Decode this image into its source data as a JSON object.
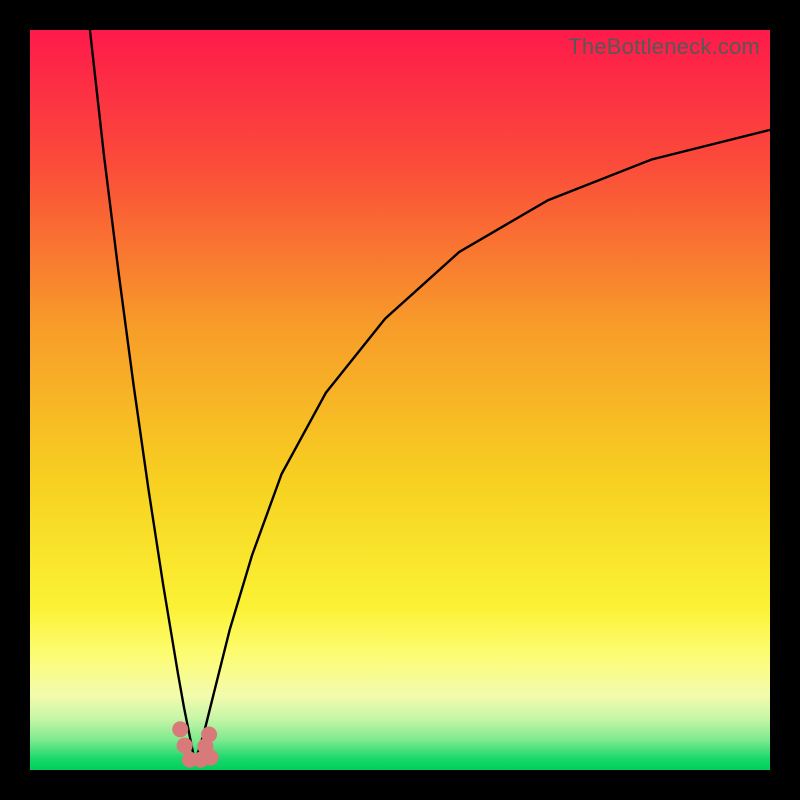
{
  "watermark": "TheBottleneck.com",
  "chart_data": {
    "type": "line",
    "title": "",
    "xlabel": "",
    "ylabel": "",
    "xlim": [
      0,
      100
    ],
    "ylim": [
      0,
      100
    ],
    "grid": false,
    "legend": false,
    "description": "Bottleneck chart: background gradient from red (top, high bottleneck) through orange/yellow to thin green band (bottom, 0%). Two black curves descend from top into a V-shaped trough at ~x=22, y≈0, then one rises steeply back toward top-right. A cluster of salmon dots sits in the trough near y=0.",
    "series": [
      {
        "name": "left-curve",
        "x": [
          8.1,
          10,
          12,
          14,
          16,
          18,
          19,
          20,
          20.8,
          21.6,
          22.3
        ],
        "y": [
          100,
          83,
          67,
          52,
          38,
          25,
          19,
          13,
          8.5,
          4.5,
          1.0
        ]
      },
      {
        "name": "right-curve",
        "x": [
          22.3,
          23.5,
          25,
          27,
          30,
          34,
          40,
          48,
          58,
          70,
          84,
          100
        ],
        "y": [
          1.0,
          5.0,
          11,
          19,
          29,
          40,
          51,
          61,
          70,
          77,
          82.5,
          86.5
        ]
      }
    ],
    "dots": {
      "name": "optimal-zone-points",
      "color": "#d87a7a",
      "points": [
        {
          "x": 20.3,
          "y": 5.5
        },
        {
          "x": 20.9,
          "y": 3.3
        },
        {
          "x": 21.6,
          "y": 1.4
        },
        {
          "x": 23.1,
          "y": 1.4
        },
        {
          "x": 23.7,
          "y": 3.2
        },
        {
          "x": 24.2,
          "y": 4.8
        },
        {
          "x": 24.4,
          "y": 1.7
        }
      ]
    },
    "gradient_stops": [
      {
        "pct": 0,
        "color": "#fe1a4b"
      },
      {
        "pct": 18,
        "color": "#fb4b3a"
      },
      {
        "pct": 40,
        "color": "#f79c29"
      },
      {
        "pct": 62,
        "color": "#f7d321"
      },
      {
        "pct": 78,
        "color": "#fbf235"
      },
      {
        "pct": 84,
        "color": "#fdfc6f"
      },
      {
        "pct": 90,
        "color": "#f3fbae"
      },
      {
        "pct": 93,
        "color": "#c7f6a7"
      },
      {
        "pct": 96,
        "color": "#7de98f"
      },
      {
        "pct": 98.5,
        "color": "#18d86b"
      },
      {
        "pct": 100,
        "color": "#00cf5c"
      }
    ]
  }
}
